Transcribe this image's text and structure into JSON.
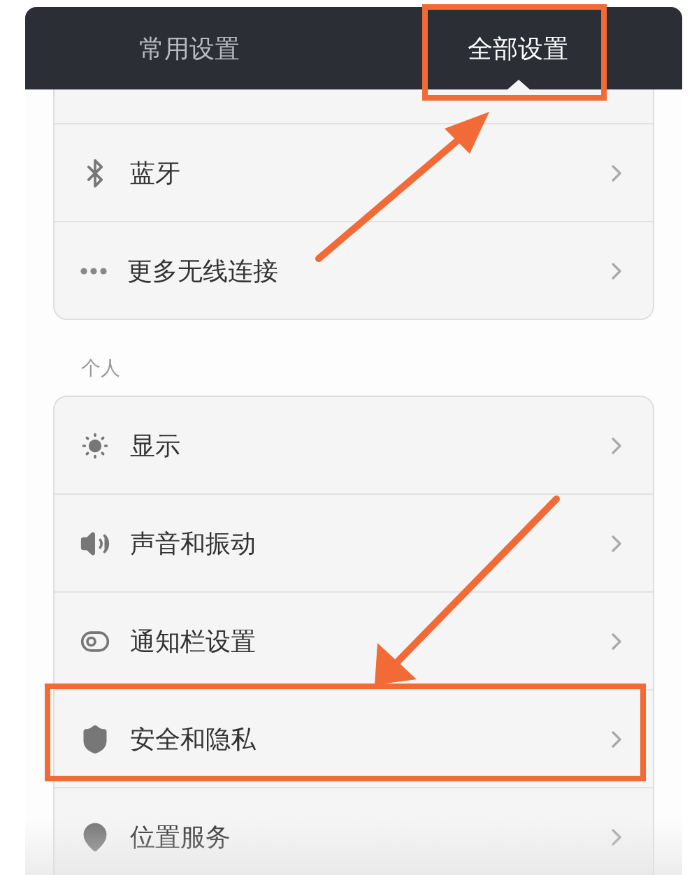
{
  "tabs": [
    {
      "label": "常用设置",
      "selected": false,
      "highlighted": false
    },
    {
      "label": "全部设置",
      "selected": true,
      "highlighted": true
    }
  ],
  "sections": [
    {
      "items": [
        {
          "label": "蓝牙",
          "highlighted": false
        },
        {
          "label": "更多无线连接",
          "highlighted": false
        }
      ]
    },
    {
      "title": "个人",
      "items": [
        {
          "label": "显示",
          "highlighted": false
        },
        {
          "label": "声音和振动",
          "highlighted": false
        },
        {
          "label": "通知栏设置",
          "highlighted": false
        },
        {
          "label": "安全和隐私",
          "highlighted": true
        },
        {
          "label": "位置服务",
          "highlighted": false
        }
      ]
    }
  ]
}
